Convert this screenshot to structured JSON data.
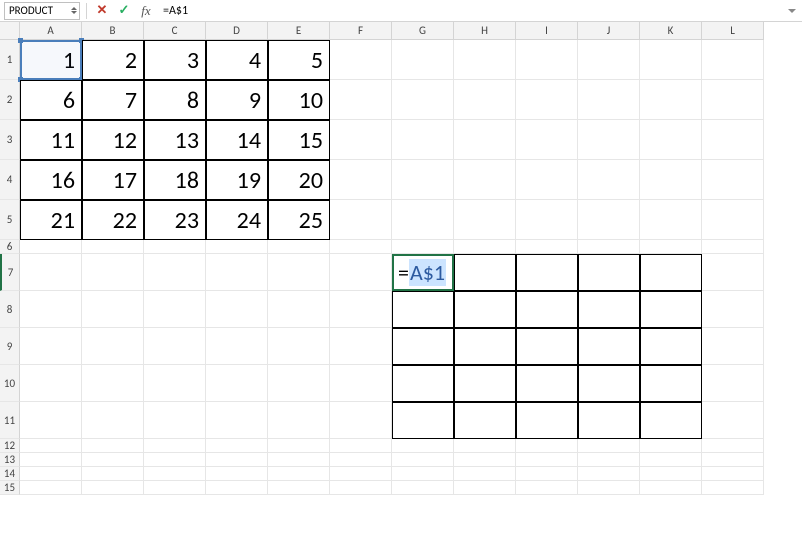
{
  "nameBox": "PRODUCT",
  "formulaBar": "=A$1",
  "columns": [
    "A",
    "B",
    "C",
    "D",
    "E",
    "F",
    "G",
    "H",
    "I",
    "J",
    "K",
    "L"
  ],
  "rows": [
    1,
    2,
    3,
    4,
    5,
    6,
    7,
    8,
    9,
    10,
    11,
    12,
    13,
    14,
    15
  ],
  "rowHeights": {
    "1": 40,
    "2": 40,
    "3": 40,
    "4": 40,
    "5": 40,
    "6": 14,
    "7": 37,
    "8": 37,
    "9": 37,
    "10": 37,
    "11": 37,
    "12": 14,
    "13": 14,
    "14": 14,
    "15": 14
  },
  "dataBlock": {
    "startRow": 1,
    "startCol": "A",
    "values": [
      [
        1,
        2,
        3,
        4,
        5
      ],
      [
        6,
        7,
        8,
        9,
        10
      ],
      [
        11,
        12,
        13,
        14,
        15
      ],
      [
        16,
        17,
        18,
        19,
        20
      ],
      [
        21,
        22,
        23,
        24,
        25
      ]
    ]
  },
  "secondTable": {
    "rows": [
      7,
      8,
      9,
      10,
      11
    ],
    "cols": [
      "G",
      "H",
      "I",
      "J",
      "K"
    ]
  },
  "editingCell": {
    "row": 7,
    "col": "G",
    "eq": "=",
    "ref": "A$1"
  },
  "sourceCell": {
    "row": 1,
    "col": "A"
  },
  "chart_data": {
    "type": "table",
    "title": "",
    "categories": [
      "A",
      "B",
      "C",
      "D",
      "E"
    ],
    "series": [
      {
        "name": "1",
        "values": [
          1,
          2,
          3,
          4,
          5
        ]
      },
      {
        "name": "2",
        "values": [
          6,
          7,
          8,
          9,
          10
        ]
      },
      {
        "name": "3",
        "values": [
          11,
          12,
          13,
          14,
          15
        ]
      },
      {
        "name": "4",
        "values": [
          16,
          17,
          18,
          19,
          20
        ]
      },
      {
        "name": "5",
        "values": [
          21,
          22,
          23,
          24,
          25
        ]
      }
    ]
  }
}
